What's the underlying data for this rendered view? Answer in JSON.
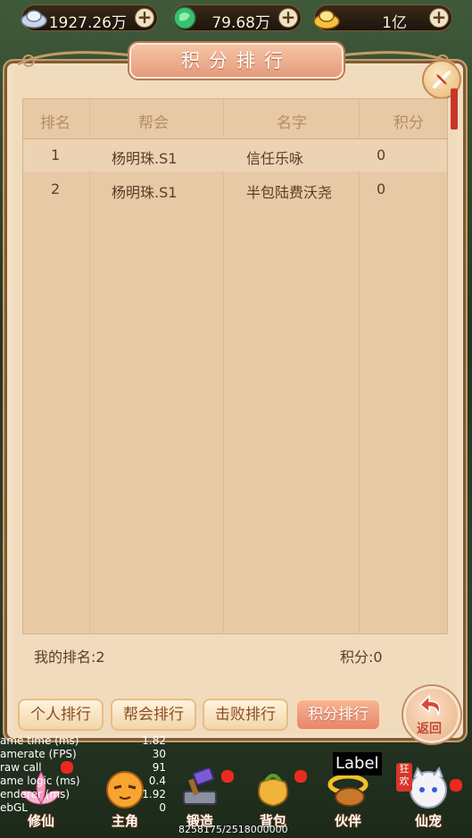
{
  "currency": {
    "silver": "1927.26万",
    "jade": "79.68万",
    "gold": "1亿"
  },
  "panel": {
    "title": "积分排行",
    "columns": [
      "排名",
      "帮会",
      "名字",
      "积分"
    ],
    "rows": [
      {
        "rank": "1",
        "guild": "杨明珠.S1",
        "name": "信任乐咏",
        "score": "0"
      },
      {
        "rank": "2",
        "guild": "杨明珠.S1",
        "name": "半包陆费沃尧",
        "score": "0"
      }
    ],
    "my_rank": "我的排名:2",
    "my_score": "积分:0"
  },
  "tabs": [
    {
      "label": "个人排行",
      "active": false
    },
    {
      "label": "帮会排行",
      "active": false
    },
    {
      "label": "击败排行",
      "active": false
    },
    {
      "label": "积分排行",
      "active": true
    }
  ],
  "return_label": "返回",
  "debug": [
    {
      "key": "ame time (ms)",
      "value": "1.82"
    },
    {
      "key": "amerate (FPS)",
      "value": "30"
    },
    {
      "key": "raw call",
      "value": "91"
    },
    {
      "key": "ame logic (ms)",
      "value": "0.4"
    },
    {
      "key": "enderer (ms)",
      "value": "1.92"
    },
    {
      "key": "ebGL",
      "value": "0"
    }
  ],
  "memory": "8258175/2518000000",
  "label_tag": "Label",
  "nav": [
    {
      "label": "修仙",
      "badge": true
    },
    {
      "label": "主角",
      "badge": false
    },
    {
      "label": "锻造",
      "badge": true
    },
    {
      "label": "背包",
      "badge": true
    },
    {
      "label": "伙伴",
      "badge": false
    },
    {
      "label": "仙宠",
      "badge": true,
      "tag": "狂欢"
    }
  ],
  "colors": {
    "accent": "#e7866b",
    "text_brown": "#5e3d25",
    "header_text": "#b78c67",
    "badge": "#ea2a1f"
  }
}
